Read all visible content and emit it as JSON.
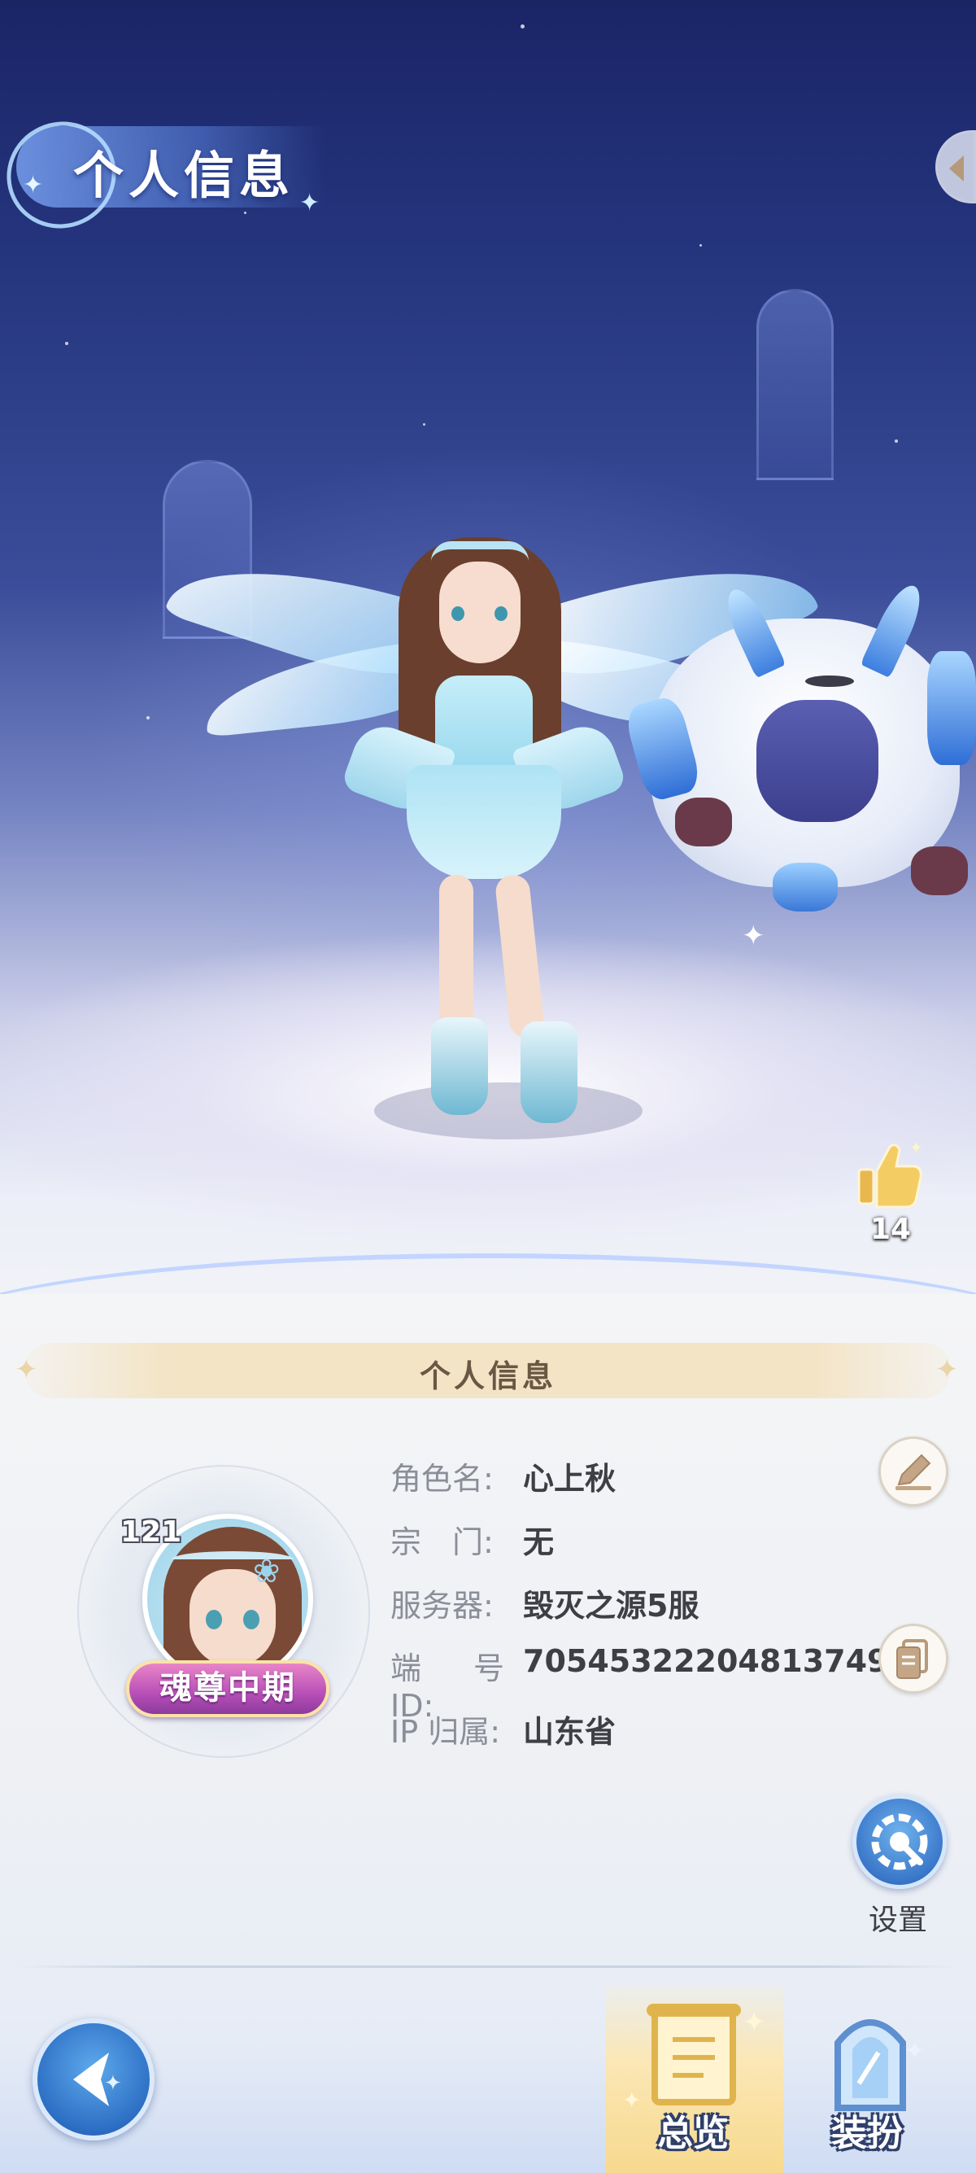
{
  "header": {
    "title": "个人信息"
  },
  "likes": {
    "count": "14"
  },
  "section": {
    "title": "个人信息"
  },
  "profile": {
    "level": "121",
    "rank": "魂尊中期",
    "fields": [
      {
        "label": "角色名:",
        "value": "心上秋"
      },
      {
        "label": "宗　门:",
        "value": "无"
      },
      {
        "label": "服务器:",
        "value": "毁灭之源5服"
      },
      {
        "label": "端号 ID:",
        "value": "70545322204813749"
      },
      {
        "label": "IP 归属:",
        "value": "山东省"
      }
    ]
  },
  "actions": {
    "settings_label": "设置"
  },
  "bottom_nav": {
    "tabs": [
      {
        "label": "总览",
        "active": true
      },
      {
        "label": "装扮",
        "active": false
      }
    ]
  },
  "colors": {
    "accent_blue": "#3a77c9",
    "gold_tab": "#f7d98e",
    "rank_pink": "#b74fb8"
  }
}
